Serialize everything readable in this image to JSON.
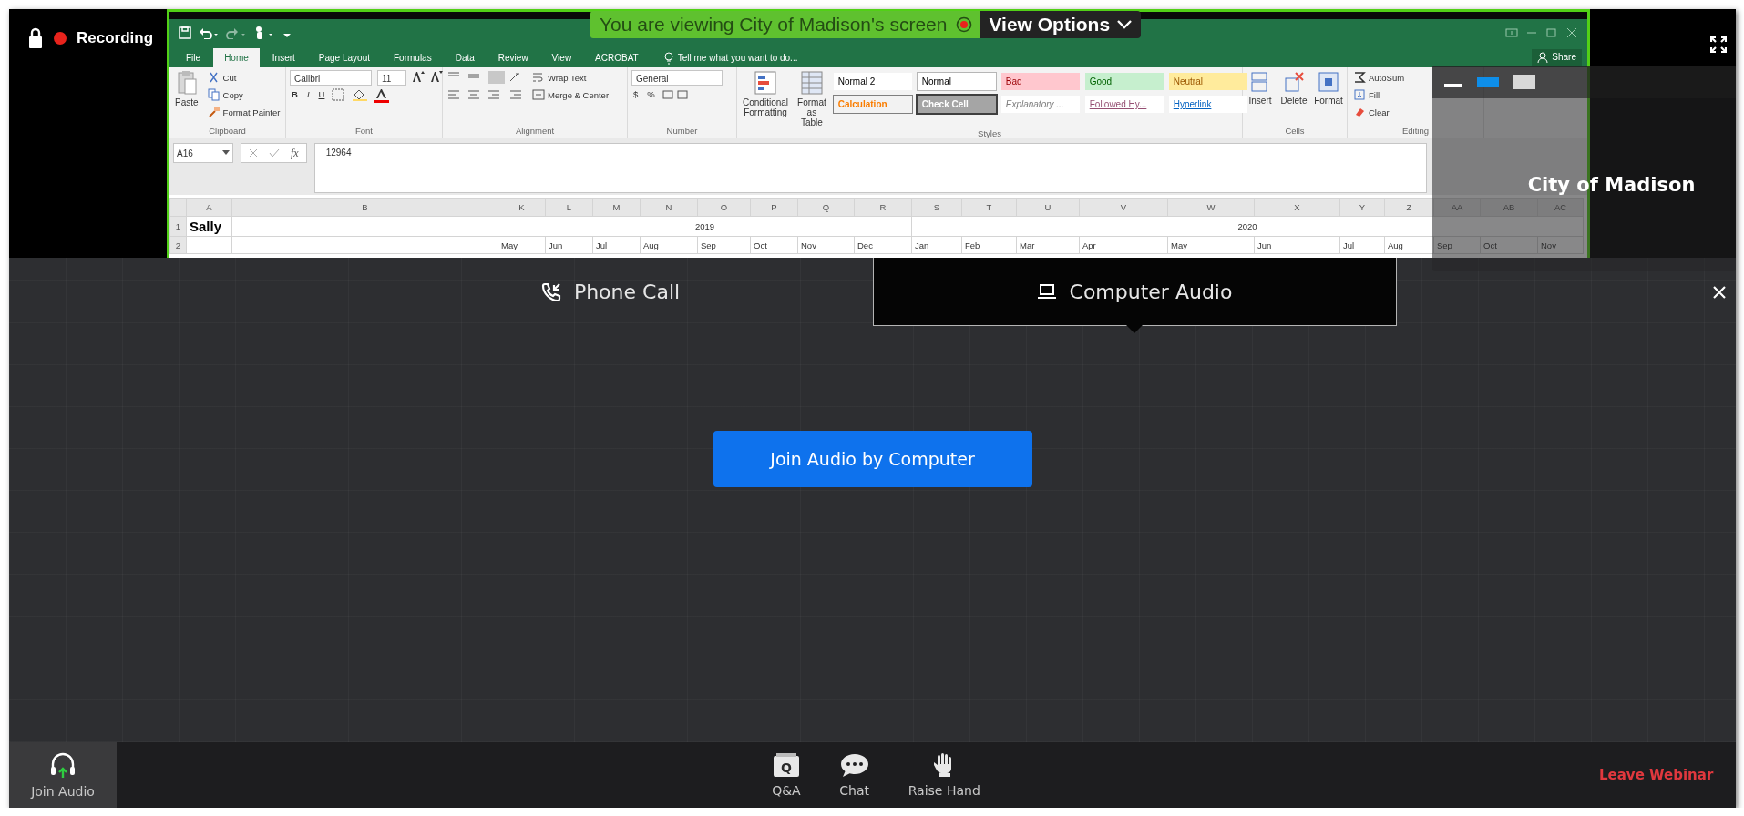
{
  "top_bar": {
    "recording_label": "Recording"
  },
  "share_banner": {
    "text": "You are viewing City of Madison's screen",
    "view_options": "View Options"
  },
  "excel": {
    "ribbon_tabs": [
      {
        "label": "File",
        "selected": false
      },
      {
        "label": "Home",
        "selected": true
      },
      {
        "label": "Insert",
        "selected": false
      },
      {
        "label": "Page Layout",
        "selected": false
      },
      {
        "label": "Formulas",
        "selected": false
      },
      {
        "label": "Data",
        "selected": false
      },
      {
        "label": "Review",
        "selected": false
      },
      {
        "label": "View",
        "selected": false
      },
      {
        "label": "ACROBAT",
        "selected": false
      }
    ],
    "tell_me": "Tell me what you want to do...",
    "share": "Share",
    "ribbon_groups": [
      {
        "kind": "clipboard",
        "label": "Clipboard",
        "main": "Paste",
        "items": [
          "Cut",
          "Copy",
          "Format Painter"
        ]
      },
      {
        "kind": "font",
        "label": "Font",
        "font": "Calibri",
        "size": "11",
        "buttons": [
          "B",
          "I",
          "U"
        ]
      },
      {
        "kind": "alignment",
        "label": "Alignment",
        "items": [
          "Wrap Text",
          "Merge & Center"
        ]
      },
      {
        "kind": "number",
        "label": "Number",
        "format": "General",
        "buttons": [
          "$",
          "%"
        ]
      },
      {
        "kind": "styles",
        "label": "Styles",
        "main": [
          "Conditional Formatting",
          "Format as Table"
        ],
        "styles": [
          {
            "kind": "plain",
            "label": "Normal 2"
          },
          {
            "kind": "normal",
            "label": "Normal"
          },
          {
            "kind": "bad",
            "label": "Bad"
          },
          {
            "kind": "good",
            "label": "Good"
          },
          {
            "kind": "neutral",
            "label": "Neutral"
          },
          {
            "kind": "calculation",
            "label": "Calculation"
          },
          {
            "kind": "check",
            "label": "Check Cell"
          },
          {
            "kind": "explanatory",
            "label": "Explanatory ..."
          },
          {
            "kind": "followed",
            "label": "Followed Hy..."
          },
          {
            "kind": "hyperlink",
            "label": "Hyperlink"
          }
        ]
      },
      {
        "kind": "cells",
        "label": "Cells",
        "main": [
          "Insert",
          "Delete",
          "Format"
        ]
      },
      {
        "kind": "editing",
        "label": "Editing",
        "items": [
          "AutoSum",
          "Fill",
          "Clear"
        ]
      }
    ],
    "formula_bar": {
      "name_box": "A16",
      "function_label": "fx",
      "value": "12964"
    },
    "sheet": {
      "columns": [
        "A",
        "B",
        "K",
        "L",
        "M",
        "N",
        "O",
        "P",
        "Q",
        "R",
        "S",
        "T",
        "U",
        "V",
        "W",
        "X",
        "Y",
        "Z",
        "AA",
        "AB",
        "AC"
      ],
      "years": [
        {
          "label": "2019",
          "months": [
            "May",
            "Jun",
            "Jul",
            "Aug",
            "Sep",
            "Oct",
            "Nov",
            "Dec"
          ]
        },
        {
          "label": "2020",
          "months": [
            "Jan",
            "Feb",
            "Mar",
            "Apr",
            "May",
            "Jun",
            "Jul",
            "Aug",
            "Sep",
            "Oct",
            "Nov"
          ]
        }
      ],
      "rows": [
        {
          "kind": "title",
          "number": "1",
          "title": "Sally"
        },
        {
          "kind": "months",
          "number": "2"
        }
      ]
    }
  },
  "presenter_panel": {
    "name": "City of Madison"
  },
  "audio_dialog": {
    "tabs": [
      {
        "kind": "phone",
        "label": "Phone Call",
        "selected": false
      },
      {
        "kind": "computer",
        "label": "Computer Audio",
        "selected": true
      }
    ],
    "join_button": "Join Audio by Computer"
  },
  "toolbar": {
    "join_audio": "Join Audio",
    "items": [
      {
        "kind": "qa",
        "label": "Q&A",
        "icon_text": "Q"
      },
      {
        "kind": "chat",
        "label": "Chat"
      },
      {
        "kind": "hand",
        "label": "Raise Hand"
      }
    ],
    "leave": "Leave Webinar"
  }
}
